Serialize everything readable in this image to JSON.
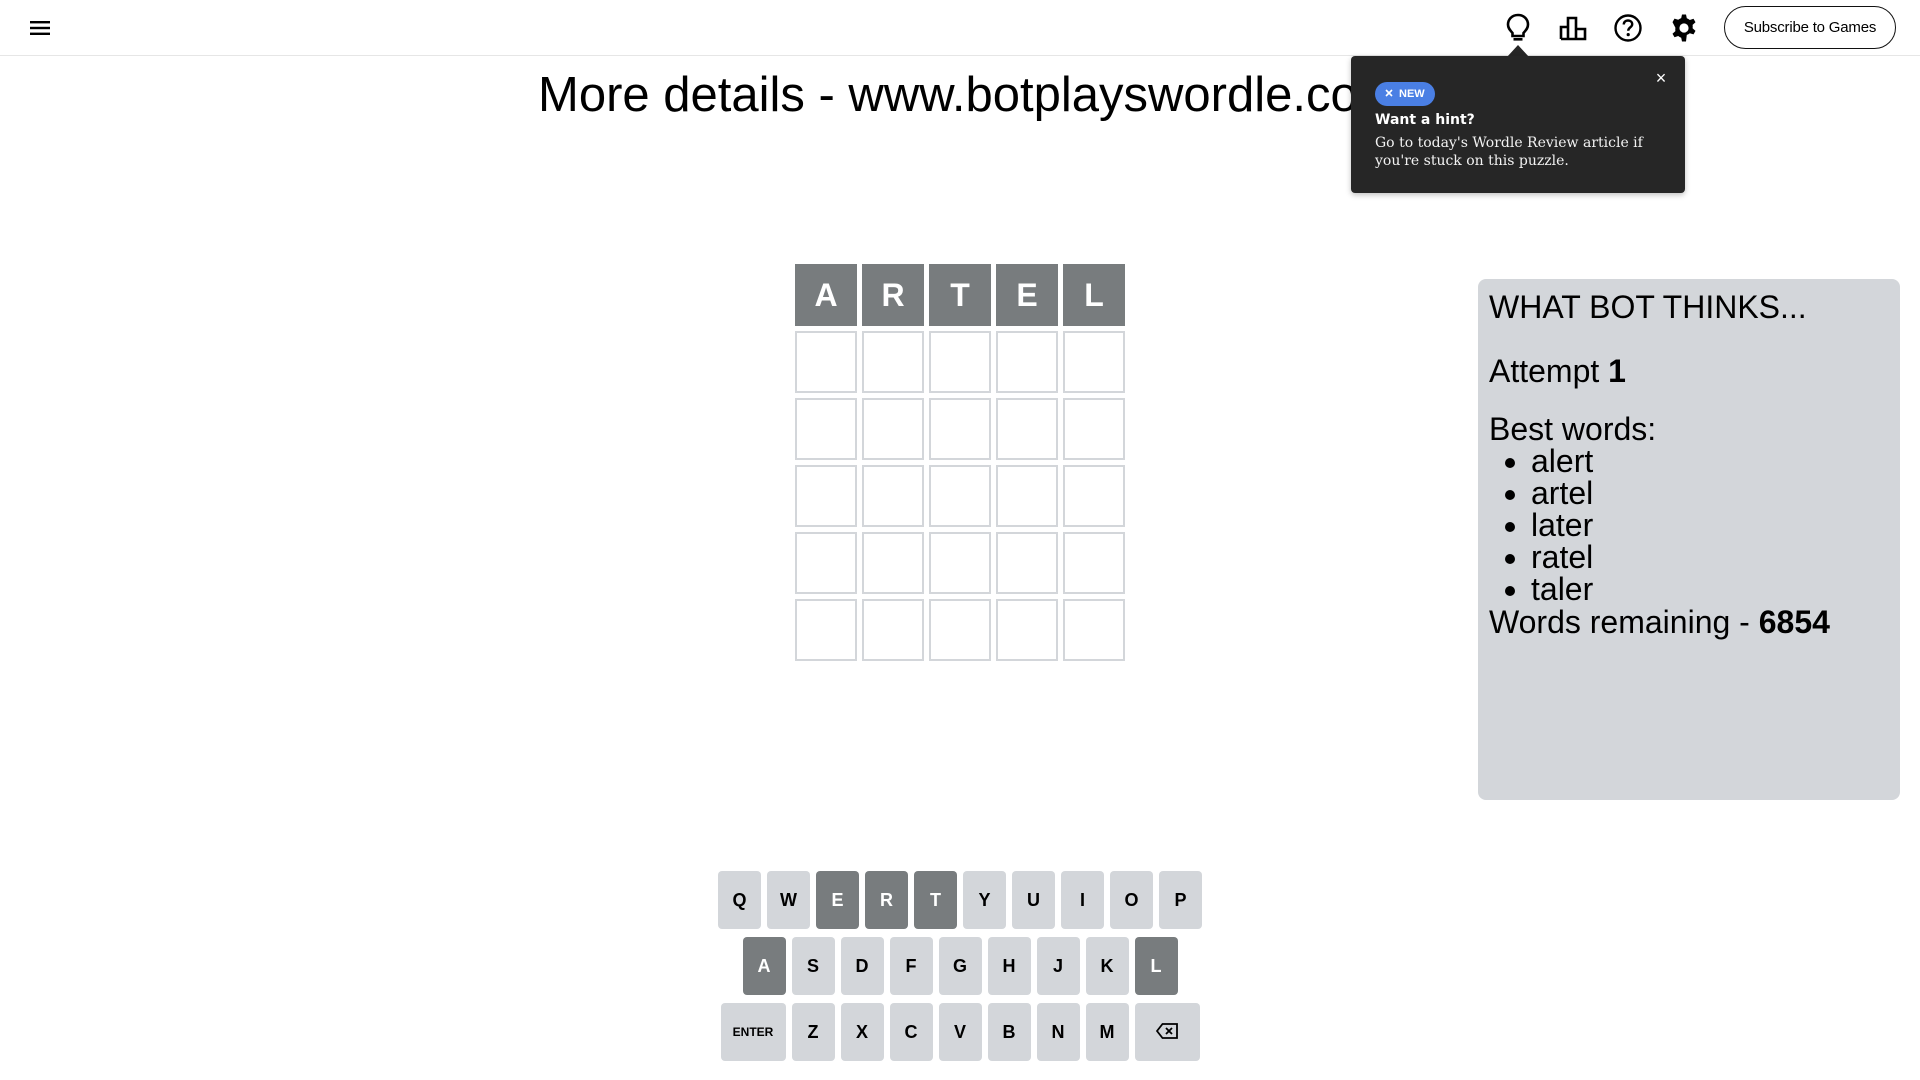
{
  "header": {
    "subscribe_label": "Subscribe to Games",
    "icons": [
      "menu-icon",
      "lightbulb-icon",
      "stats-icon",
      "help-icon",
      "settings-icon"
    ]
  },
  "headline": "More details - www.botplayswordle.com",
  "hint_popover": {
    "badge": "NEW",
    "title": "Want a hint?",
    "body": "Go to today's Wordle Review article if you're stuck on this puzzle.",
    "close": "×"
  },
  "board": {
    "rows": [
      [
        {
          "letter": "A",
          "state": "absent"
        },
        {
          "letter": "R",
          "state": "absent"
        },
        {
          "letter": "T",
          "state": "absent"
        },
        {
          "letter": "E",
          "state": "absent"
        },
        {
          "letter": "L",
          "state": "absent"
        }
      ],
      [
        {
          "letter": "",
          "state": "empty"
        },
        {
          "letter": "",
          "state": "empty"
        },
        {
          "letter": "",
          "state": "empty"
        },
        {
          "letter": "",
          "state": "empty"
        },
        {
          "letter": "",
          "state": "empty"
        }
      ],
      [
        {
          "letter": "",
          "state": "empty"
        },
        {
          "letter": "",
          "state": "empty"
        },
        {
          "letter": "",
          "state": "empty"
        },
        {
          "letter": "",
          "state": "empty"
        },
        {
          "letter": "",
          "state": "empty"
        }
      ],
      [
        {
          "letter": "",
          "state": "empty"
        },
        {
          "letter": "",
          "state": "empty"
        },
        {
          "letter": "",
          "state": "empty"
        },
        {
          "letter": "",
          "state": "empty"
        },
        {
          "letter": "",
          "state": "empty"
        }
      ],
      [
        {
          "letter": "",
          "state": "empty"
        },
        {
          "letter": "",
          "state": "empty"
        },
        {
          "letter": "",
          "state": "empty"
        },
        {
          "letter": "",
          "state": "empty"
        },
        {
          "letter": "",
          "state": "empty"
        }
      ],
      [
        {
          "letter": "",
          "state": "empty"
        },
        {
          "letter": "",
          "state": "empty"
        },
        {
          "letter": "",
          "state": "empty"
        },
        {
          "letter": "",
          "state": "empty"
        },
        {
          "letter": "",
          "state": "empty"
        }
      ]
    ]
  },
  "bot_panel": {
    "title": "WHAT BOT THINKS...",
    "attempt_label": "Attempt ",
    "attempt_value": "1",
    "best_words_label": "Best words:",
    "best_words": [
      "alert",
      "artel",
      "later",
      "ratel",
      "taler"
    ],
    "remaining_label": "Words remaining - ",
    "remaining_value": "6854"
  },
  "keyboard": {
    "rows": [
      [
        {
          "label": "Q",
          "state": ""
        },
        {
          "label": "W",
          "state": ""
        },
        {
          "label": "E",
          "state": "absent"
        },
        {
          "label": "R",
          "state": "absent"
        },
        {
          "label": "T",
          "state": "absent"
        },
        {
          "label": "Y",
          "state": ""
        },
        {
          "label": "U",
          "state": ""
        },
        {
          "label": "I",
          "state": ""
        },
        {
          "label": "O",
          "state": ""
        },
        {
          "label": "P",
          "state": ""
        }
      ],
      [
        {
          "label": "A",
          "state": "absent"
        },
        {
          "label": "S",
          "state": ""
        },
        {
          "label": "D",
          "state": ""
        },
        {
          "label": "F",
          "state": ""
        },
        {
          "label": "G",
          "state": ""
        },
        {
          "label": "H",
          "state": ""
        },
        {
          "label": "J",
          "state": ""
        },
        {
          "label": "K",
          "state": ""
        },
        {
          "label": "L",
          "state": "absent"
        }
      ],
      [
        {
          "label": "ENTER",
          "state": "",
          "wide": true
        },
        {
          "label": "Z",
          "state": ""
        },
        {
          "label": "X",
          "state": ""
        },
        {
          "label": "C",
          "state": ""
        },
        {
          "label": "V",
          "state": ""
        },
        {
          "label": "B",
          "state": ""
        },
        {
          "label": "N",
          "state": ""
        },
        {
          "label": "M",
          "state": ""
        },
        {
          "label": "",
          "state": "",
          "wide": true,
          "icon": "backspace-icon"
        }
      ]
    ]
  },
  "colors": {
    "absent": "#787c7e",
    "key_default": "#d3d6da",
    "tile_border": "#d3d6da",
    "popover_bg": "#262626",
    "badge_blue": "#4a7fe4",
    "panel_bg": "#d3d6da"
  }
}
